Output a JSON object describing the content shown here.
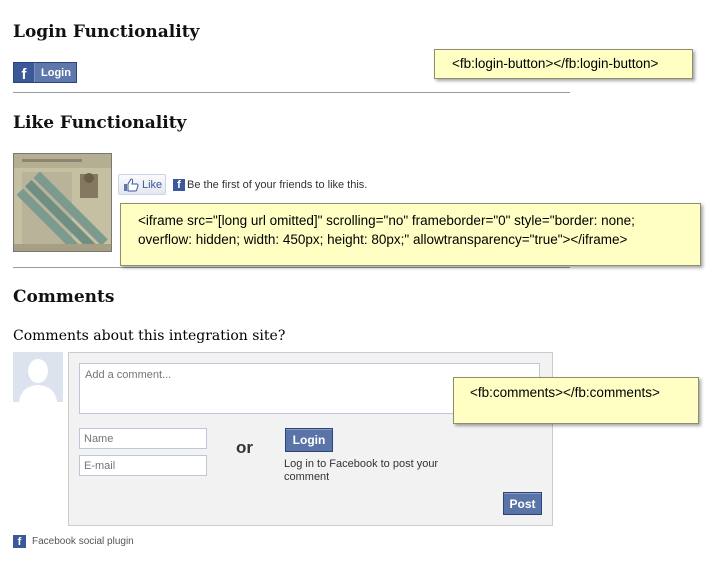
{
  "sections": {
    "login_title": "Login Functionality",
    "like_title": "Like Functionality",
    "comments_title": "Comments"
  },
  "login_button": {
    "label": "Login"
  },
  "notes": {
    "login_tag": "<fb:login-button></fb:login-button>",
    "iframe_tag": "<iframe src=\"[long url omitted]\" scrolling=\"no\" frameborder=\"0\" style=\"border: none; overflow: hidden; width: 450px; height: 80px;\" allowtransparency=\"true\"></iframe>",
    "comments_tag": "<fb:comments></fb:comments>"
  },
  "like": {
    "button_label": "Like",
    "social_text": "Be the first of your friends to like this."
  },
  "comments": {
    "prompt": "Comments about this integration site?",
    "comment_placeholder": "Add a comment...",
    "name_placeholder": "Name",
    "email_placeholder": "E-mail",
    "or_label": "or",
    "login_label": "Login",
    "login_hint": "Log in to Facebook to post your comment",
    "post_label": "Post",
    "plugin_label": "Facebook social plugin"
  },
  "colors": {
    "fb_blue": "#3b5998",
    "note_yellow": "#ffffc4",
    "panel_gray": "#f2f2f2"
  },
  "icons": [
    "facebook-icon",
    "thumbs-up-icon",
    "avatar-silhouette-icon"
  ]
}
